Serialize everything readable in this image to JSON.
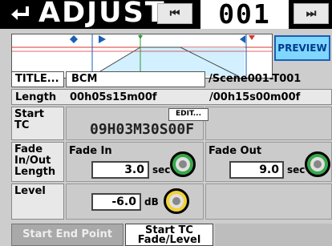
{
  "header": {
    "back_icon": "return-arrow-icon",
    "title": "ADJUST",
    "prev_icon": "skip-back-icon",
    "counter": "001",
    "next_icon": "skip-forward-icon"
  },
  "preview_label": "PREVIEW",
  "title_row": {
    "button": "TITLE...",
    "name": "BCM",
    "path": "/Scene001-T001"
  },
  "length_row": {
    "label": "Length",
    "value": "00h05s15m00f",
    "total": "/00h15s00m00f"
  },
  "start_tc": {
    "label_line1": "Start",
    "label_line2": "TC",
    "edit_button": "EDIT...",
    "timecode": "09H03M30S00F"
  },
  "fade": {
    "label_line1": "Fade",
    "label_line2": "In/Out",
    "label_line3": "Length",
    "fade_in_label": "Fade In",
    "fade_in_value": "3.0",
    "fade_in_unit": "sec",
    "fade_out_label": "Fade Out",
    "fade_out_value": "9.0",
    "fade_out_unit": "sec"
  },
  "level": {
    "label": "Level",
    "value": "-6.0",
    "unit": "dB"
  },
  "tabs": [
    {
      "label": "Start End Point",
      "active": false
    },
    {
      "label": "Start TC\nFade/Level",
      "active": true
    }
  ],
  "colors": {
    "accent_blue": "#1a5fb4",
    "knob_green": "#38a84a",
    "knob_yellow": "#f0d238"
  }
}
